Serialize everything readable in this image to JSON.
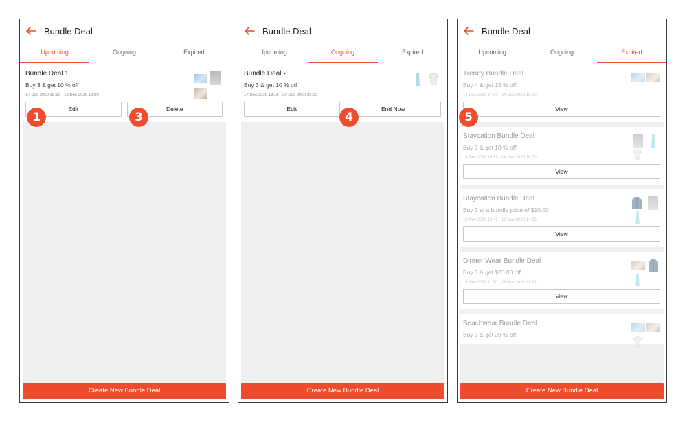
{
  "accent_color": "#ee4d2d",
  "screens": [
    {
      "title": "Bundle Deal",
      "tabs": [
        "Upcoming",
        "Ongoing",
        "Expired"
      ],
      "active_tab": "Upcoming",
      "deal": {
        "name": "Bundle Deal 1",
        "offer": "Buy 3 & get  10  % off",
        "date": "17 Dec 2020 18:30 - 18 Dec 2020 19:30",
        "buttons": [
          "Edit",
          "Delete"
        ]
      },
      "create_label": "Create New Bundle Deal"
    },
    {
      "title": "Bundle Deal",
      "tabs": [
        "Upcoming",
        "Ongoing",
        "Expired"
      ],
      "active_tab": "Ongoing",
      "deal": {
        "name": "Bundle Deal 2",
        "offer": "Buy 3 & get  10  % off",
        "date": "17 Dec 2020 18:16 - 20 Dec 2020 20:00",
        "buttons": [
          "Edit",
          "End Now"
        ]
      },
      "create_label": "Create New Bundle Deal"
    },
    {
      "title": "Bundle Deal",
      "tabs": [
        "Upcoming",
        "Ongoing",
        "Expired"
      ],
      "active_tab": "Expired",
      "deals": [
        {
          "name": "Trendy Bundle Deal",
          "offer": "Buy 4 & get  15  % off",
          "date": "14 Dec 2020 17:00 - 14 Dec 2020 19:00",
          "button": "View"
        },
        {
          "name": "Staycation Bundle Deal",
          "offer": "Buy 3 & get  10  % off",
          "date": "14 Dec 2020 14:58 - 14 Dec 2020 16:00",
          "button": "View"
        },
        {
          "name": "Staycation Bundle Deal",
          "offer": "Buy 3 at a bundle price of $10.00",
          "date": "10 Nov 2020 12:43 - 10 Nov 2020 14:00",
          "button": "View"
        },
        {
          "name": "Dinner Wear Bundle Deal",
          "offer": "Buy 3 & get $20.00 off",
          "date": "16 Nov 2020 11:30 - 18 Nov 2020 12:30",
          "button": "View"
        },
        {
          "name": "Beachwear Bundle Deal",
          "offer": "Buy 3 & get  20  % off",
          "date": "",
          "button": ""
        }
      ],
      "create_label": "Create New Bundle Deal"
    }
  ],
  "step_badges": [
    "1",
    "3",
    "4",
    "5"
  ]
}
